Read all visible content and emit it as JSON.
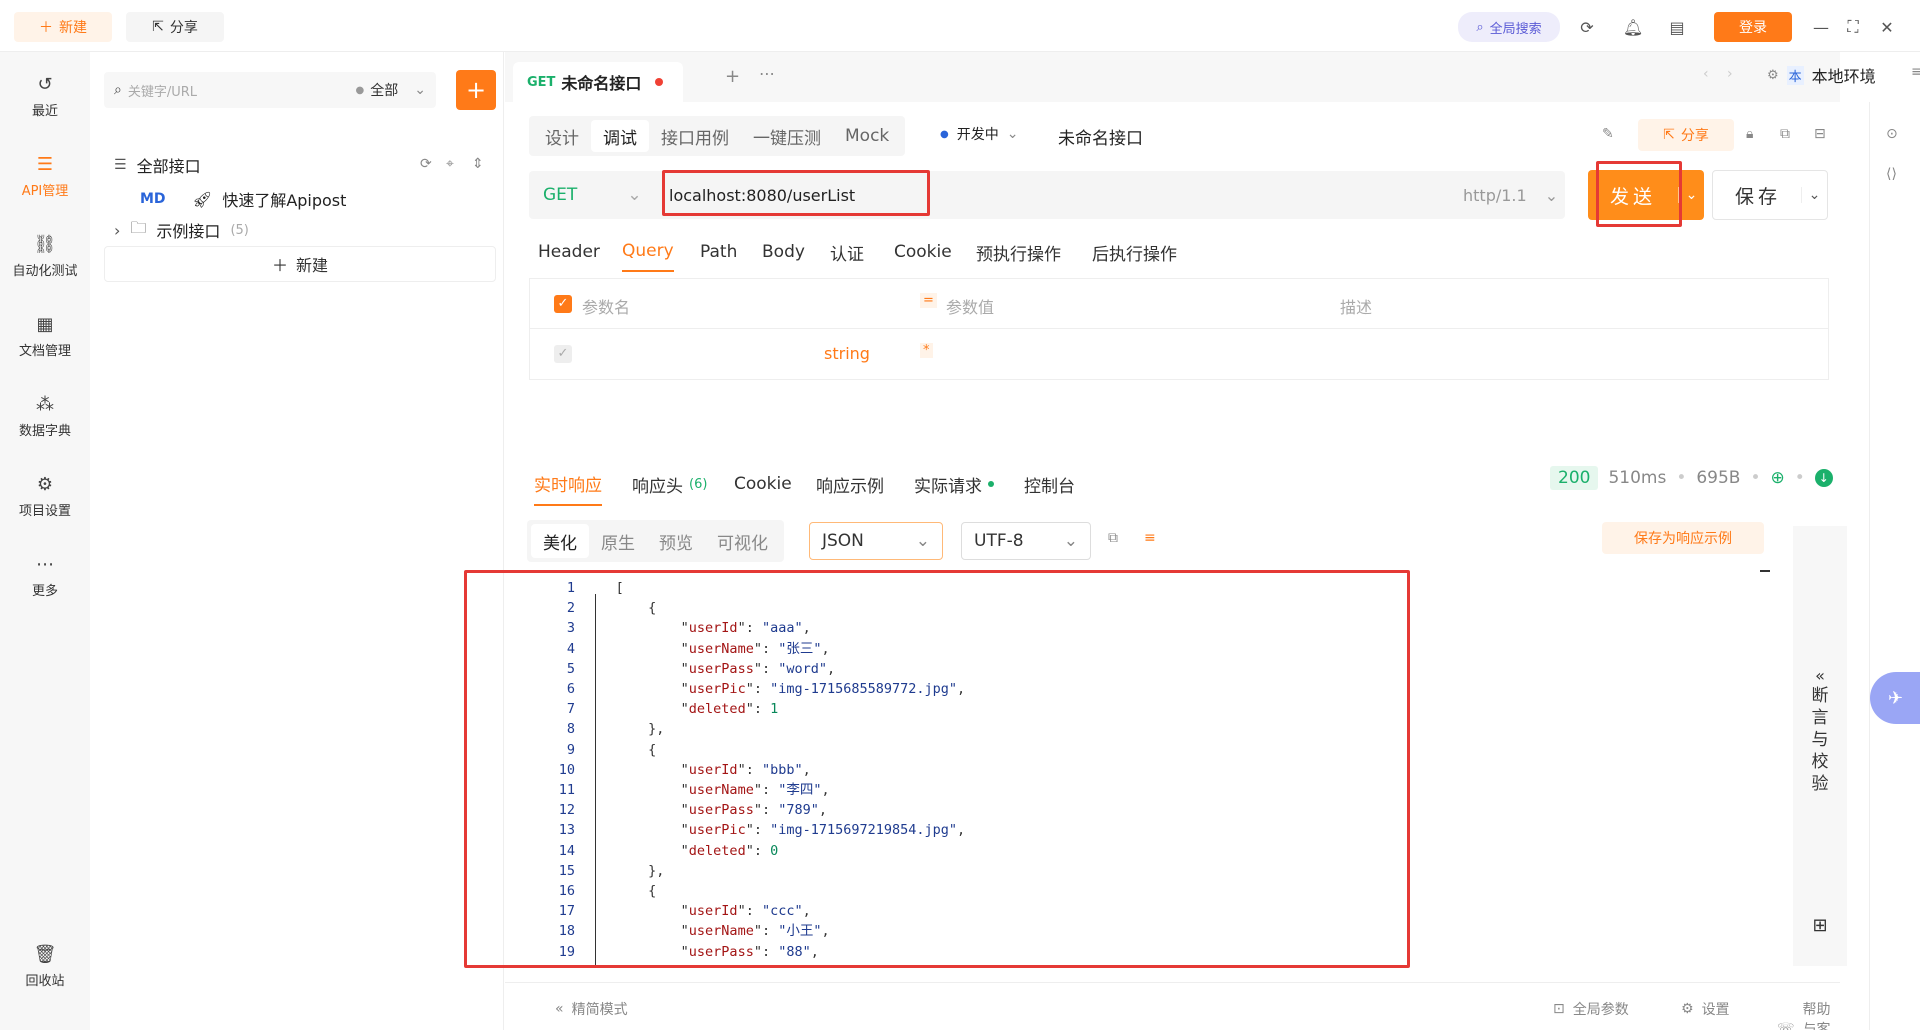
{
  "topbar": {
    "new_label": "新建",
    "share_label": "分享",
    "global_search_label": "全局搜索",
    "login_label": "登录"
  },
  "rail": {
    "items": [
      {
        "label": "最近",
        "icon": "history-icon"
      },
      {
        "label": "API管理",
        "icon": "api-icon"
      },
      {
        "label": "自动化测试",
        "icon": "automation-icon"
      },
      {
        "label": "文档管理",
        "icon": "document-icon"
      },
      {
        "label": "数据字典",
        "icon": "dictionary-icon"
      },
      {
        "label": "项目设置",
        "icon": "settings-icon"
      },
      {
        "label": "更多",
        "icon": "more-icon"
      },
      {
        "label": "回收站",
        "icon": "trash-icon"
      }
    ]
  },
  "tree": {
    "search_placeholder": "关键字/URL",
    "scope": "全部",
    "all_label": "全部接口",
    "md_tag": "MD",
    "quick_start": "快速了解Apipost",
    "folder_name": "示例接口",
    "folder_count": "(5)",
    "new_label": "新建"
  },
  "tab": {
    "method": "GET",
    "title": "未命名接口",
    "env": "本地环境",
    "env_badge": "本"
  },
  "request": {
    "mode_tabs": [
      "设计",
      "调试",
      "接口用例",
      "一键压测",
      "Mock"
    ],
    "status": "开发中",
    "name": "未命名接口",
    "share_label": "分享",
    "method": "GET",
    "url": "localhost:8080/userList",
    "http_version": "http/1.1",
    "send_label": "发送",
    "save_label": "保存",
    "param_tabs": [
      "Header",
      "Query",
      "Path",
      "Body",
      "认证",
      "Cookie",
      "预执行操作",
      "后执行操作"
    ],
    "table": {
      "col_name": "参数名",
      "col_value": "参数值",
      "col_desc": "描述",
      "row_type": "string",
      "required_mark": "*"
    }
  },
  "response": {
    "tabs": [
      "实时响应",
      "响应头",
      "Cookie",
      "响应示例",
      "实际请求",
      "控制台"
    ],
    "header_count": "(6)",
    "status_code": "200",
    "time": "510ms",
    "size": "695B",
    "view_tabs": [
      "美化",
      "原生",
      "预览",
      "可视化"
    ],
    "format": "JSON",
    "encoding": "UTF-8",
    "save_example_label": "保存为响应示例",
    "assert_label": [
      "断",
      "言",
      "与",
      "校",
      "验"
    ]
  },
  "code_lines": [
    {
      "n": "1",
      "t": "["
    },
    {
      "n": "2",
      "t": "    {"
    },
    {
      "n": "3",
      "k": "userId",
      "v": "\"aaa\"",
      "vt": "str"
    },
    {
      "n": "4",
      "k": "userName",
      "v": "\"张三\"",
      "vt": "str"
    },
    {
      "n": "5",
      "k": "userPass",
      "v": "\"word\"",
      "vt": "str"
    },
    {
      "n": "6",
      "k": "userPic",
      "v": "\"img-1715685589772.jpg\"",
      "vt": "str"
    },
    {
      "n": "7",
      "k": "deleted",
      "v": "1",
      "vt": "num",
      "last": true
    },
    {
      "n": "8",
      "t": "    },"
    },
    {
      "n": "9",
      "t": "    {"
    },
    {
      "n": "10",
      "k": "userId",
      "v": "\"bbb\"",
      "vt": "str"
    },
    {
      "n": "11",
      "k": "userName",
      "v": "\"李四\"",
      "vt": "str"
    },
    {
      "n": "12",
      "k": "userPass",
      "v": "\"789\"",
      "vt": "str"
    },
    {
      "n": "13",
      "k": "userPic",
      "v": "\"img-1715697219854.jpg\"",
      "vt": "str"
    },
    {
      "n": "14",
      "k": "deleted",
      "v": "0",
      "vt": "num",
      "last": true
    },
    {
      "n": "15",
      "t": "    },"
    },
    {
      "n": "16",
      "t": "    {"
    },
    {
      "n": "17",
      "k": "userId",
      "v": "\"ccc\"",
      "vt": "str"
    },
    {
      "n": "18",
      "k": "userName",
      "v": "\"小王\"",
      "vt": "str"
    },
    {
      "n": "19",
      "k": "userPass",
      "v": "\"88\"",
      "vt": "str"
    }
  ],
  "bottombar": {
    "compact_mode": "精简模式",
    "global_params": "全局参数",
    "settings": "设置",
    "help": "帮助与客服"
  },
  "colors": {
    "accent": "#ff7a18",
    "get_green": "#1bb06b",
    "highlight_red": "#e53935"
  }
}
